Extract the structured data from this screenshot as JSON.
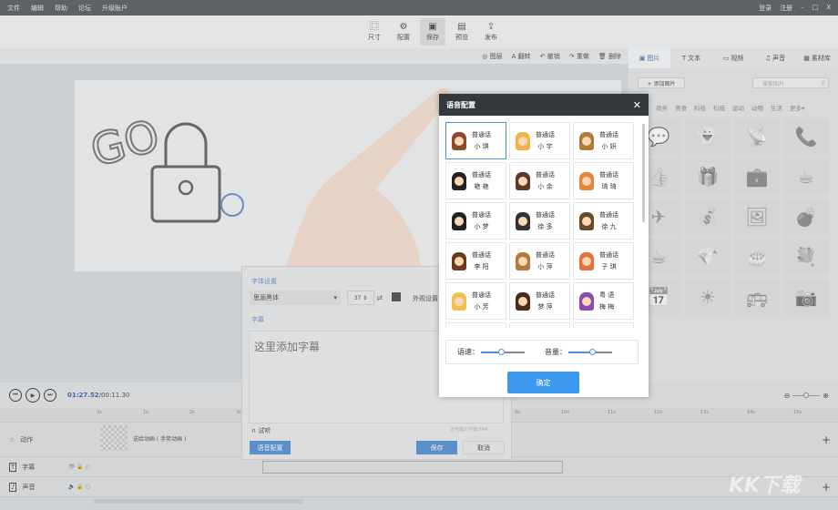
{
  "menu": [
    "文件",
    "编辑",
    "帮助",
    "论坛",
    "升级账户"
  ],
  "window": {
    "login": "登录",
    "register": "注册",
    "minimize": "–",
    "maximize": "□",
    "close": "X"
  },
  "toolbar": [
    {
      "label": "尺寸",
      "icon": "⿴"
    },
    {
      "label": "配置",
      "icon": "⚙"
    },
    {
      "label": "保存",
      "icon": "▣"
    },
    {
      "label": "预览",
      "icon": "▤"
    },
    {
      "label": "发布",
      "icon": "⇪"
    }
  ],
  "subbar": [
    {
      "label": "图层",
      "icon": "◎"
    },
    {
      "label": "翻转",
      "icon": "A"
    },
    {
      "label": "撤销",
      "icon": "↶"
    },
    {
      "label": "重做",
      "icon": "↷"
    },
    {
      "label": "删除",
      "icon": "🗑"
    }
  ],
  "right_panel": {
    "tabs": [
      {
        "label": "图片",
        "icon": "▣"
      },
      {
        "label": "文本",
        "icon": "T"
      },
      {
        "label": "视频",
        "icon": "▭"
      },
      {
        "label": "声音",
        "icon": "♫"
      },
      {
        "label": "素材库",
        "icon": "▦"
      }
    ],
    "add_image": "+ 添加图片",
    "search_placeholder": "搜索图片",
    "categories": [
      "商务",
      "美食",
      "科技",
      "科技",
      "运动",
      "动物",
      "生活",
      "更多▾"
    ],
    "icons": [
      "💬",
      "👻",
      "📡",
      "📞",
      "👍",
      "🎁",
      "💼",
      "☕",
      "✈",
      "💰",
      "🖼",
      "💣",
      "☕",
      "💎",
      "🎂",
      "💐",
      "📅",
      "☀",
      "🚌",
      "📷"
    ]
  },
  "playback": {
    "current": "01:27.52",
    "total": "/00:11.30"
  },
  "ruler": [
    "0s",
    "1s",
    "2s",
    "3s",
    "4s",
    "5s",
    "6s",
    "7s",
    "8s",
    "9s",
    "10s",
    "11s",
    "12s",
    "13s",
    "14s",
    "15s"
  ],
  "tracks": [
    {
      "label": "动作",
      "icon": "☆"
    },
    {
      "label": "字幕",
      "icon": "T"
    },
    {
      "label": "声音",
      "icon": "♪"
    }
  ],
  "clip": {
    "label": "送给动画 ( 手势动画 )"
  },
  "subtitle_panel": {
    "font_title": "字体设置",
    "font": "思源黑体",
    "size": "37",
    "unit": "pt",
    "appearance": "外观设置",
    "caption_title": "字幕",
    "text": "这里添加字幕",
    "listen": "试听",
    "remaining": "还可输入字数:764",
    "voice_config": "语音配置",
    "save": "保存",
    "cancel": "取消"
  },
  "dialog": {
    "title": "语音配置",
    "close": "✕",
    "voices": [
      {
        "type": "普通话",
        "name": "小 琪",
        "hair": "#8b4a2b"
      },
      {
        "type": "普通话",
        "name": "小 宇",
        "hair": "#f0b34a"
      },
      {
        "type": "普通话",
        "name": "小 妍",
        "hair": "#b07a3a"
      },
      {
        "type": "普通话",
        "name": "艳 艳",
        "hair": "#222"
      },
      {
        "type": "普通话",
        "name": "小 余",
        "hair": "#5a3a2a"
      },
      {
        "type": "普通话",
        "name": "琦 琦",
        "hair": "#e8843a"
      },
      {
        "type": "普通话",
        "name": "小 梦",
        "hair": "#222"
      },
      {
        "type": "普通话",
        "name": "徐 多",
        "hair": "#333"
      },
      {
        "type": "普通话",
        "name": "徐 九",
        "hair": "#6a4a2a"
      },
      {
        "type": "普通话",
        "name": "李 阳",
        "hair": "#6a3a1a"
      },
      {
        "type": "普通话",
        "name": "小 萍",
        "hair": "#b07a3a"
      },
      {
        "type": "普通话",
        "name": "子 琪",
        "hair": "#e8703a"
      },
      {
        "type": "普通话",
        "name": "小 芳",
        "hair": "#f0c050"
      },
      {
        "type": "普通话",
        "name": "梦 萍",
        "hair": "#4a2a1a"
      },
      {
        "type": "粤 语",
        "name": "梅 梅",
        "hair": "#8a4ab0"
      }
    ],
    "speed_label": "语速：",
    "speed": 0.45,
    "volume_label": "音量：",
    "volume": 0.55,
    "confirm": "确定"
  }
}
